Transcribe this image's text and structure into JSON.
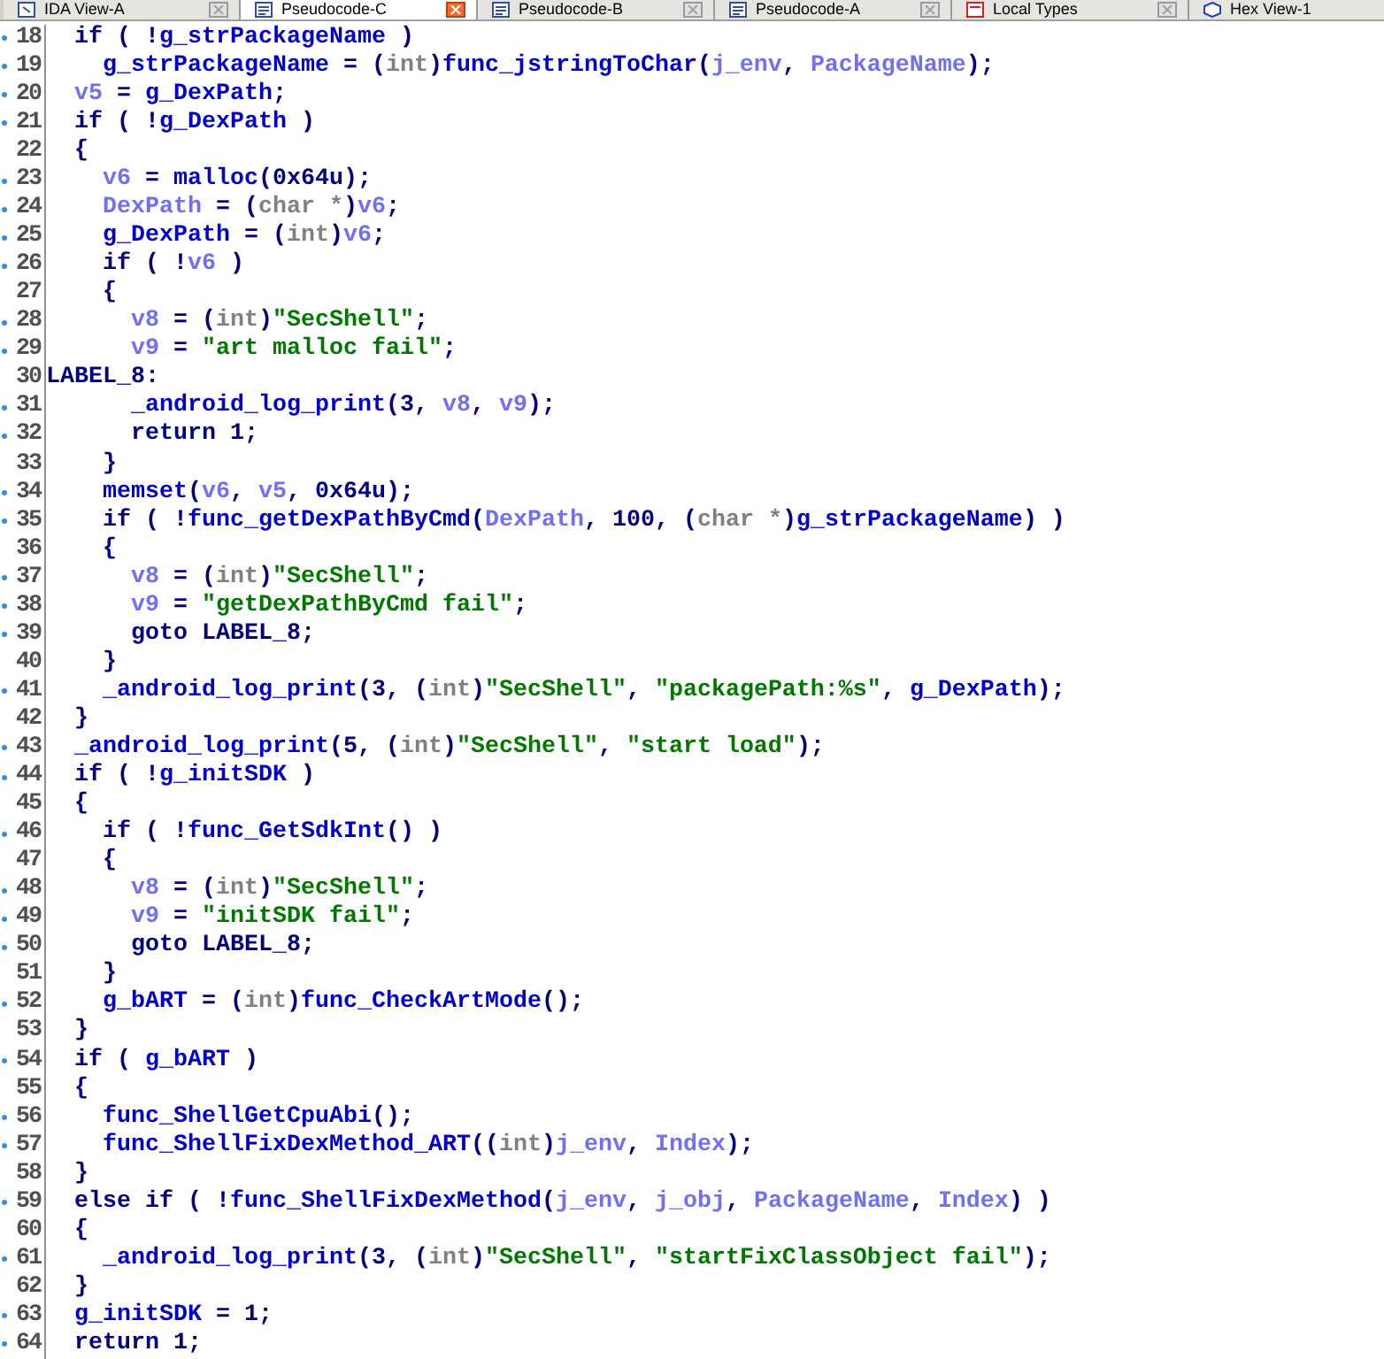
{
  "tabs": [
    {
      "label": "IDA View-A",
      "kind": "graph",
      "selected": false
    },
    {
      "label": "Pseudocode-C",
      "kind": "pseudocode",
      "selected": true
    },
    {
      "label": "Pseudocode-B",
      "kind": "pseudocode",
      "selected": false
    },
    {
      "label": "Pseudocode-A",
      "kind": "pseudocode",
      "selected": false
    },
    {
      "label": "Local Types",
      "kind": "types",
      "selected": false
    },
    {
      "label": "Hex View-1",
      "kind": "hex",
      "selected": false
    }
  ],
  "code_lines": [
    {
      "number": "18",
      "marked": true,
      "tokens": [
        {
          "kind": "code",
          "text": "  if ( !"
        },
        {
          "kind": "name",
          "text": "g_strPackageName"
        },
        {
          "kind": "code",
          "text": " )"
        }
      ]
    },
    {
      "number": "19",
      "marked": true,
      "tokens": [
        {
          "kind": "name",
          "text": "    g_strPackageName"
        },
        {
          "kind": "code",
          "text": " = ("
        },
        {
          "kind": "type",
          "text": "int"
        },
        {
          "kind": "code",
          "text": ")"
        },
        {
          "kind": "name",
          "text": "func_jstringToChar"
        },
        {
          "kind": "code",
          "text": "("
        },
        {
          "kind": "var",
          "text": "j_env"
        },
        {
          "kind": "code",
          "text": ", "
        },
        {
          "kind": "var",
          "text": "PackageName"
        },
        {
          "kind": "code",
          "text": ");"
        }
      ]
    },
    {
      "number": "20",
      "marked": true,
      "tokens": [
        {
          "kind": "var",
          "text": "  v5"
        },
        {
          "kind": "code",
          "text": " = "
        },
        {
          "kind": "name",
          "text": "g_DexPath"
        },
        {
          "kind": "code",
          "text": ";"
        }
      ]
    },
    {
      "number": "21",
      "marked": true,
      "tokens": [
        {
          "kind": "code",
          "text": "  if ( !"
        },
        {
          "kind": "name",
          "text": "g_DexPath"
        },
        {
          "kind": "code",
          "text": " )"
        }
      ]
    },
    {
      "number": "22",
      "marked": false,
      "tokens": [
        {
          "kind": "code",
          "text": "  {"
        }
      ]
    },
    {
      "number": "23",
      "marked": true,
      "tokens": [
        {
          "kind": "var",
          "text": "    v6"
        },
        {
          "kind": "code",
          "text": " = "
        },
        {
          "kind": "name",
          "text": "malloc"
        },
        {
          "kind": "code",
          "text": "(0x64u);"
        }
      ]
    },
    {
      "number": "24",
      "marked": true,
      "tokens": [
        {
          "kind": "var",
          "text": "    DexPath"
        },
        {
          "kind": "code",
          "text": " = ("
        },
        {
          "kind": "type",
          "text": "char *"
        },
        {
          "kind": "code",
          "text": ")"
        },
        {
          "kind": "var",
          "text": "v6"
        },
        {
          "kind": "code",
          "text": ";"
        }
      ]
    },
    {
      "number": "25",
      "marked": true,
      "tokens": [
        {
          "kind": "name",
          "text": "    g_DexPath"
        },
        {
          "kind": "code",
          "text": " = ("
        },
        {
          "kind": "type",
          "text": "int"
        },
        {
          "kind": "code",
          "text": ")"
        },
        {
          "kind": "var",
          "text": "v6"
        },
        {
          "kind": "code",
          "text": ";"
        }
      ]
    },
    {
      "number": "26",
      "marked": true,
      "tokens": [
        {
          "kind": "code",
          "text": "    if ( !"
        },
        {
          "kind": "var",
          "text": "v6"
        },
        {
          "kind": "code",
          "text": " )"
        }
      ]
    },
    {
      "number": "27",
      "marked": false,
      "tokens": [
        {
          "kind": "code",
          "text": "    {"
        }
      ]
    },
    {
      "number": "28",
      "marked": true,
      "tokens": [
        {
          "kind": "var",
          "text": "      v8"
        },
        {
          "kind": "code",
          "text": " = ("
        },
        {
          "kind": "type",
          "text": "int"
        },
        {
          "kind": "code",
          "text": ")"
        },
        {
          "kind": "str",
          "text": "\"SecShell\""
        },
        {
          "kind": "code",
          "text": ";"
        }
      ]
    },
    {
      "number": "29",
      "marked": true,
      "tokens": [
        {
          "kind": "var",
          "text": "      v9"
        },
        {
          "kind": "code",
          "text": " = "
        },
        {
          "kind": "str",
          "text": "\"art malloc fail\""
        },
        {
          "kind": "code",
          "text": ";"
        }
      ]
    },
    {
      "number": "30",
      "marked": false,
      "tokens": [
        {
          "kind": "code",
          "text": "LABEL_8:"
        }
      ]
    },
    {
      "number": "31",
      "marked": true,
      "tokens": [
        {
          "kind": "name",
          "text": "      _android_log_print"
        },
        {
          "kind": "code",
          "text": "(3, "
        },
        {
          "kind": "var",
          "text": "v8"
        },
        {
          "kind": "code",
          "text": ", "
        },
        {
          "kind": "var",
          "text": "v9"
        },
        {
          "kind": "code",
          "text": ");"
        }
      ]
    },
    {
      "number": "32",
      "marked": true,
      "tokens": [
        {
          "kind": "code",
          "text": "      return 1;"
        }
      ]
    },
    {
      "number": "33",
      "marked": false,
      "tokens": [
        {
          "kind": "code",
          "text": "    }"
        }
      ]
    },
    {
      "number": "34",
      "marked": true,
      "tokens": [
        {
          "kind": "name",
          "text": "    memset"
        },
        {
          "kind": "code",
          "text": "("
        },
        {
          "kind": "var",
          "text": "v6"
        },
        {
          "kind": "code",
          "text": ", "
        },
        {
          "kind": "var",
          "text": "v5"
        },
        {
          "kind": "code",
          "text": ", 0x64u);"
        }
      ]
    },
    {
      "number": "35",
      "marked": true,
      "tokens": [
        {
          "kind": "code",
          "text": "    if ( !"
        },
        {
          "kind": "name",
          "text": "func_getDexPathByCmd"
        },
        {
          "kind": "code",
          "text": "("
        },
        {
          "kind": "var",
          "text": "DexPath"
        },
        {
          "kind": "code",
          "text": ", 100, ("
        },
        {
          "kind": "type",
          "text": "char *"
        },
        {
          "kind": "code",
          "text": ")"
        },
        {
          "kind": "name",
          "text": "g_strPackageName"
        },
        {
          "kind": "code",
          "text": ") )"
        }
      ]
    },
    {
      "number": "36",
      "marked": false,
      "tokens": [
        {
          "kind": "code",
          "text": "    {"
        }
      ]
    },
    {
      "number": "37",
      "marked": true,
      "tokens": [
        {
          "kind": "var",
          "text": "      v8"
        },
        {
          "kind": "code",
          "text": " = ("
        },
        {
          "kind": "type",
          "text": "int"
        },
        {
          "kind": "code",
          "text": ")"
        },
        {
          "kind": "str",
          "text": "\"SecShell\""
        },
        {
          "kind": "code",
          "text": ";"
        }
      ]
    },
    {
      "number": "38",
      "marked": true,
      "tokens": [
        {
          "kind": "var",
          "text": "      v9"
        },
        {
          "kind": "code",
          "text": " = "
        },
        {
          "kind": "str",
          "text": "\"getDexPathByCmd fail\""
        },
        {
          "kind": "code",
          "text": ";"
        }
      ]
    },
    {
      "number": "39",
      "marked": true,
      "tokens": [
        {
          "kind": "code",
          "text": "      goto LABEL_8;"
        }
      ]
    },
    {
      "number": "40",
      "marked": false,
      "tokens": [
        {
          "kind": "code",
          "text": "    }"
        }
      ]
    },
    {
      "number": "41",
      "marked": true,
      "tokens": [
        {
          "kind": "name",
          "text": "    _android_log_print"
        },
        {
          "kind": "code",
          "text": "(3, ("
        },
        {
          "kind": "type",
          "text": "int"
        },
        {
          "kind": "code",
          "text": ")"
        },
        {
          "kind": "str",
          "text": "\"SecShell\""
        },
        {
          "kind": "code",
          "text": ", "
        },
        {
          "kind": "str",
          "text": "\"packagePath:%s\""
        },
        {
          "kind": "code",
          "text": ", "
        },
        {
          "kind": "name",
          "text": "g_DexPath"
        },
        {
          "kind": "code",
          "text": ");"
        }
      ]
    },
    {
      "number": "42",
      "marked": false,
      "tokens": [
        {
          "kind": "code",
          "text": "  }"
        }
      ]
    },
    {
      "number": "43",
      "marked": true,
      "tokens": [
        {
          "kind": "name",
          "text": "  _android_log_print"
        },
        {
          "kind": "code",
          "text": "(5, ("
        },
        {
          "kind": "type",
          "text": "int"
        },
        {
          "kind": "code",
          "text": ")"
        },
        {
          "kind": "str",
          "text": "\"SecShell\""
        },
        {
          "kind": "code",
          "text": ", "
        },
        {
          "kind": "str",
          "text": "\"start load\""
        },
        {
          "kind": "code",
          "text": ");"
        }
      ]
    },
    {
      "number": "44",
      "marked": true,
      "tokens": [
        {
          "kind": "code",
          "text": "  if ( !"
        },
        {
          "kind": "name",
          "text": "g_initSDK"
        },
        {
          "kind": "code",
          "text": " )"
        }
      ]
    },
    {
      "number": "45",
      "marked": false,
      "tokens": [
        {
          "kind": "code",
          "text": "  {"
        }
      ]
    },
    {
      "number": "46",
      "marked": true,
      "tokens": [
        {
          "kind": "code",
          "text": "    if ( !"
        },
        {
          "kind": "name",
          "text": "func_GetSdkInt"
        },
        {
          "kind": "code",
          "text": "() )"
        }
      ]
    },
    {
      "number": "47",
      "marked": false,
      "tokens": [
        {
          "kind": "code",
          "text": "    {"
        }
      ]
    },
    {
      "number": "48",
      "marked": true,
      "tokens": [
        {
          "kind": "var",
          "text": "      v8"
        },
        {
          "kind": "code",
          "text": " = ("
        },
        {
          "kind": "type",
          "text": "int"
        },
        {
          "kind": "code",
          "text": ")"
        },
        {
          "kind": "str",
          "text": "\"SecShell\""
        },
        {
          "kind": "code",
          "text": ";"
        }
      ]
    },
    {
      "number": "49",
      "marked": true,
      "tokens": [
        {
          "kind": "var",
          "text": "      v9"
        },
        {
          "kind": "code",
          "text": " = "
        },
        {
          "kind": "str",
          "text": "\"initSDK fail\""
        },
        {
          "kind": "code",
          "text": ";"
        }
      ]
    },
    {
      "number": "50",
      "marked": true,
      "tokens": [
        {
          "kind": "code",
          "text": "      goto LABEL_8;"
        }
      ]
    },
    {
      "number": "51",
      "marked": false,
      "tokens": [
        {
          "kind": "code",
          "text": "    }"
        }
      ]
    },
    {
      "number": "52",
      "marked": true,
      "tokens": [
        {
          "kind": "name",
          "text": "    g_bART"
        },
        {
          "kind": "code",
          "text": " = ("
        },
        {
          "kind": "type",
          "text": "int"
        },
        {
          "kind": "code",
          "text": ")"
        },
        {
          "kind": "name",
          "text": "func_CheckArtMode"
        },
        {
          "kind": "code",
          "text": "();"
        }
      ]
    },
    {
      "number": "53",
      "marked": false,
      "tokens": [
        {
          "kind": "code",
          "text": "  }"
        }
      ]
    },
    {
      "number": "54",
      "marked": true,
      "tokens": [
        {
          "kind": "code",
          "text": "  if ( "
        },
        {
          "kind": "name",
          "text": "g_bART"
        },
        {
          "kind": "code",
          "text": " )"
        }
      ]
    },
    {
      "number": "55",
      "marked": false,
      "tokens": [
        {
          "kind": "code",
          "text": "  {"
        }
      ]
    },
    {
      "number": "56",
      "marked": true,
      "tokens": [
        {
          "kind": "name",
          "text": "    func_ShellGetCpuAbi"
        },
        {
          "kind": "code",
          "text": "();"
        }
      ]
    },
    {
      "number": "57",
      "marked": true,
      "tokens": [
        {
          "kind": "name",
          "text": "    func_ShellFixDexMethod_ART"
        },
        {
          "kind": "code",
          "text": "(("
        },
        {
          "kind": "type",
          "text": "int"
        },
        {
          "kind": "code",
          "text": ")"
        },
        {
          "kind": "var",
          "text": "j_env"
        },
        {
          "kind": "code",
          "text": ", "
        },
        {
          "kind": "var",
          "text": "Index"
        },
        {
          "kind": "code",
          "text": ");"
        }
      ]
    },
    {
      "number": "58",
      "marked": false,
      "tokens": [
        {
          "kind": "code",
          "text": "  }"
        }
      ]
    },
    {
      "number": "59",
      "marked": true,
      "tokens": [
        {
          "kind": "code",
          "text": "  else if ( !"
        },
        {
          "kind": "name",
          "text": "func_ShellFixDexMethod"
        },
        {
          "kind": "code",
          "text": "("
        },
        {
          "kind": "var",
          "text": "j_env"
        },
        {
          "kind": "code",
          "text": ", "
        },
        {
          "kind": "var",
          "text": "j_obj"
        },
        {
          "kind": "code",
          "text": ", "
        },
        {
          "kind": "var",
          "text": "PackageName"
        },
        {
          "kind": "code",
          "text": ", "
        },
        {
          "kind": "var",
          "text": "Index"
        },
        {
          "kind": "code",
          "text": ") )"
        }
      ]
    },
    {
      "number": "60",
      "marked": false,
      "tokens": [
        {
          "kind": "code",
          "text": "  {"
        }
      ]
    },
    {
      "number": "61",
      "marked": true,
      "tokens": [
        {
          "kind": "name",
          "text": "    _android_log_print"
        },
        {
          "kind": "code",
          "text": "(3, ("
        },
        {
          "kind": "type",
          "text": "int"
        },
        {
          "kind": "code",
          "text": ")"
        },
        {
          "kind": "str",
          "text": "\"SecShell\""
        },
        {
          "kind": "code",
          "text": ", "
        },
        {
          "kind": "str",
          "text": "\"startFixClassObject fail\""
        },
        {
          "kind": "code",
          "text": ");"
        }
      ]
    },
    {
      "number": "62",
      "marked": false,
      "tokens": [
        {
          "kind": "code",
          "text": "  }"
        }
      ]
    },
    {
      "number": "63",
      "marked": true,
      "tokens": [
        {
          "kind": "name",
          "text": "  g_initSDK"
        },
        {
          "kind": "code",
          "text": " = 1;"
        }
      ]
    },
    {
      "number": "64",
      "marked": true,
      "tokens": [
        {
          "kind": "code",
          "text": "  return 1;"
        }
      ]
    }
  ]
}
